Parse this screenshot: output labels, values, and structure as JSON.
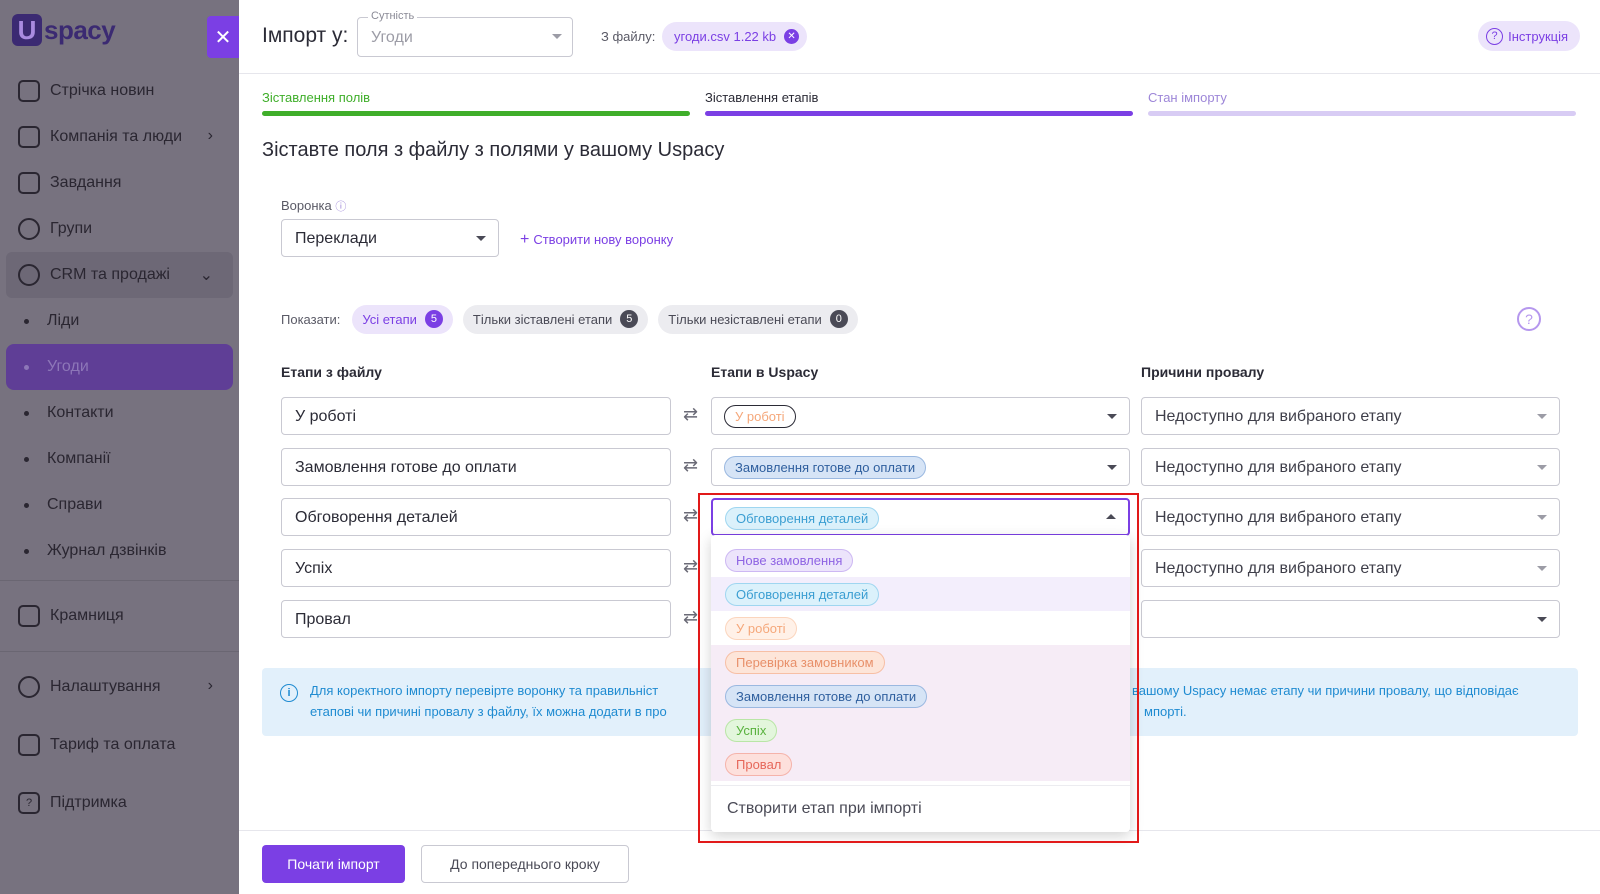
{
  "sidebar": {
    "logo": "spacy",
    "logo_letter": "U",
    "close_glyph": "✕",
    "items": [
      {
        "label": "Стрічка новин",
        "icon": "home-icon"
      },
      {
        "label": "Компанія та люди",
        "icon": "building-icon"
      },
      {
        "label": "Завдання",
        "icon": "calendar-icon"
      },
      {
        "label": "Групи",
        "icon": "users-icon"
      },
      {
        "label": "CRM та продажі",
        "icon": "database-icon"
      }
    ],
    "crm_sub": [
      "Ліди",
      "Угоди",
      "Контакти",
      "Компанії",
      "Справи",
      "Журнал дзвінків"
    ],
    "bottom": [
      {
        "label": "Крамниця",
        "icon": "store-icon"
      },
      {
        "label": "Налаштування",
        "icon": "gear-icon"
      },
      {
        "label": "Тариф та оплата",
        "icon": "wallet-icon"
      },
      {
        "label": "Підтримка",
        "icon": "help-chat-icon"
      }
    ]
  },
  "topbar": {
    "title": "Імпорт у:",
    "entity_label": "Сутність",
    "entity_value": "Угоди",
    "file_label": "З файлу:",
    "file_chip": "угоди.csv 1.22 kb",
    "instruction": "Інструкція"
  },
  "steps": [
    {
      "label": "Зіставлення полів",
      "state": "done"
    },
    {
      "label": "Зіставлення етапів",
      "state": "active"
    },
    {
      "label": "Стан імпорту",
      "state": "pending"
    }
  ],
  "heading": "Зіставте поля з файлу з полями у вашому Uspacy",
  "funnel": {
    "label": "Воронка",
    "value": "Переклади",
    "create": "Створити нову воронку"
  },
  "filters": {
    "label": "Показати:",
    "pills": [
      {
        "label": "Усі етапи",
        "count": "5"
      },
      {
        "label": "Тільки зіставлені етапи",
        "count": "5"
      },
      {
        "label": "Тільки незіставлені етапи",
        "count": "0"
      }
    ]
  },
  "columns": {
    "file": "Етапи з файлу",
    "uspacy": "Етапи в Uspacy",
    "reasons": "Причини провалу"
  },
  "rows": [
    {
      "file": "У роботі",
      "stage": "У роботі",
      "reason": "Недоступно для вибраного етапу"
    },
    {
      "file": "Замовлення готове до оплати",
      "stage": "Замовлення готове до оплати",
      "reason": "Недоступно для вибраного етапу"
    },
    {
      "file": "Обговорення деталей",
      "stage": "Обговорення деталей",
      "reason": "Недоступно для вибраного етапу"
    },
    {
      "file": "Успіх",
      "stage": "",
      "reason": "Недоступно для вибраного етапу"
    },
    {
      "file": "Провал",
      "stage": "",
      "reason": ""
    }
  ],
  "dropdown": {
    "options": [
      "Нове замовлення",
      "Обговорення деталей",
      "У роботі",
      "Перевірка замовником",
      "Замовлення готове до оплати",
      "Успіх",
      "Провал"
    ],
    "create": "Створити етап при імпорті"
  },
  "info": {
    "left_line1": "Для коректного імпорту перевірте воронку та правильніст",
    "left_line2": "етапові чи причині провалу з файлу, їх можна додати в про",
    "right_line1": "вашому Uspacy немає етапу чи причини провалу, що відповідає",
    "right_line2": "мпорті."
  },
  "buttons": {
    "start": "Почати імпорт",
    "back": "До попереднього кроку"
  },
  "colors": {
    "accent": "#7b3fe4",
    "step_done": "#3fae2a",
    "step_active": "#7b3fe4",
    "highlight": "#e11919"
  }
}
